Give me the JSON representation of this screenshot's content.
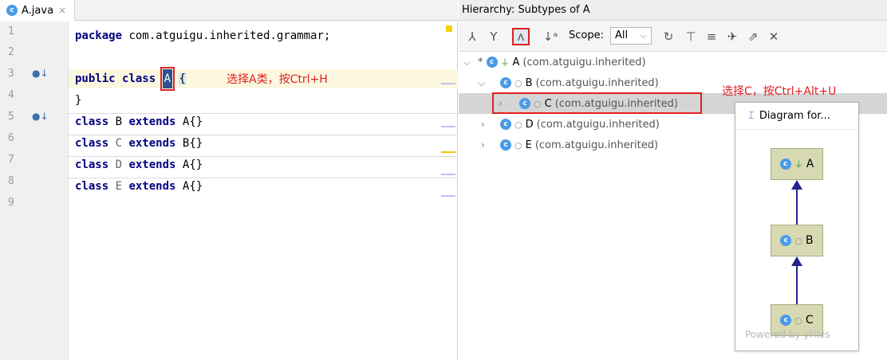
{
  "editor": {
    "tab": {
      "label": "A.java",
      "close": "×",
      "badge": "c"
    },
    "lines": {
      "n1": "1",
      "n2": "2",
      "n3": "3",
      "n4": "4",
      "n5": "5",
      "n6": "6",
      "n7": "7",
      "n8": "8",
      "n9": "9"
    },
    "code": {
      "l1_kw": "package",
      "l1_rest": " com.atguigu.inherited.grammar;",
      "l3_kw1": "public",
      "l3_kw2": "class",
      "l3_name": "A",
      "l3_rest": "{",
      "l4": "}",
      "l5_kw": "class",
      "l5_name": " B ",
      "l5_kw2": "extends",
      "l5_rest": " A{}",
      "l6_kw": "class",
      "l6_name": " C ",
      "l6_kw2": "extends",
      "l6_rest": " B{}",
      "l7_kw": "class",
      "l7_name": " D ",
      "l7_kw2": "extends",
      "l7_rest": " A{}",
      "l8_kw": "class",
      "l8_name": " E ",
      "l8_kw2": "extends",
      "l8_rest": " A{}"
    },
    "annotation": "选择A类，按Ctrl+H"
  },
  "hierarchy": {
    "title": "Hierarchy:  Subtypes of A",
    "scope_label": "Scope:",
    "scope_value": "All",
    "icons": {
      "subtypes": "subtypes-icon",
      "supertypes": "supertypes-icon",
      "class-hierarchy": "class-hierarchy-icon",
      "sort": "sort-alpha-icon",
      "refresh": "refresh-icon",
      "expand": "expand-all-icon",
      "collapse": "collapse-all-icon",
      "pin": "pin-icon",
      "export": "export-icon",
      "close": "close-icon"
    },
    "tree": {
      "a": {
        "name": "A",
        "pkg": "(com.atguigu.inherited)"
      },
      "b": {
        "name": "B",
        "pkg": "(com.atguigu.inherited)"
      },
      "c": {
        "name": "C",
        "pkg": "(com.atguigu.inherited)"
      },
      "d": {
        "name": "D",
        "pkg": "(com.atguigu.inherited)"
      },
      "e": {
        "name": "E",
        "pkg": "(com.atguigu.inherited)"
      }
    },
    "annotation": "选择C，按Ctrl+Alt+U"
  },
  "diagram": {
    "title": "Diagram for...",
    "nodes": {
      "a": "A",
      "b": "B",
      "c": "C"
    },
    "watermark": "Powered by yFiles"
  },
  "colors": {
    "annotation_red": "#e02020",
    "keyword_navy": "#000080",
    "class_badge": "#4b9ae8",
    "node_fill": "#d6d9b1"
  }
}
